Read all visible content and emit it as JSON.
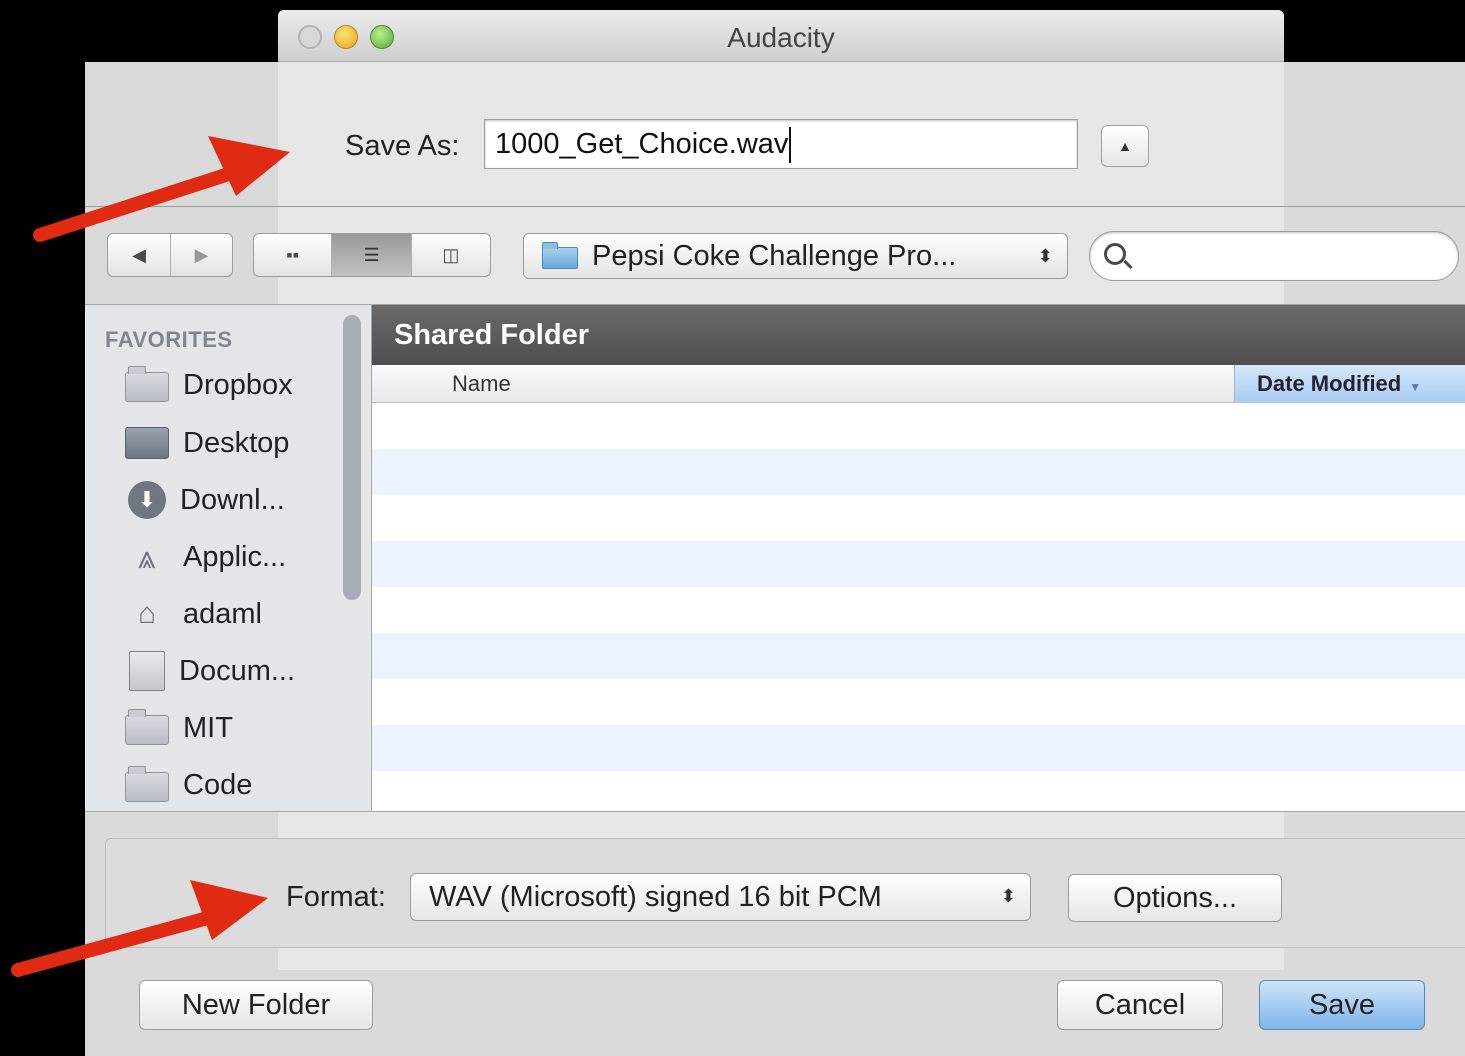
{
  "window": {
    "title": "Audacity",
    "controls": [
      "close",
      "minimize",
      "zoom"
    ]
  },
  "save_as": {
    "label": "Save As:",
    "value": "1000_Get_Choice.wav",
    "expand_icon": "triangle-up-icon"
  },
  "toolbar": {
    "back_icon": "◀",
    "forward_icon": "▶",
    "view_icon_grid": "▪▪",
    "view_icon_list": "☰",
    "view_icon_columns": "◫",
    "location": "Pepsi Coke Challenge Pro...",
    "search_placeholder": ""
  },
  "sidebar": {
    "heading": "FAVORITES",
    "items": [
      {
        "label": "Dropbox",
        "icon": "folder-icon"
      },
      {
        "label": "Desktop",
        "icon": "desktop-icon"
      },
      {
        "label": "Downl...",
        "icon": "download-icon"
      },
      {
        "label": "Applic...",
        "icon": "applications-icon"
      },
      {
        "label": "adaml",
        "icon": "home-icon"
      },
      {
        "label": "Docum...",
        "icon": "documents-icon"
      },
      {
        "label": "MIT",
        "icon": "folder-icon"
      },
      {
        "label": "Code",
        "icon": "folder-icon"
      }
    ]
  },
  "file_list": {
    "folder_title": "Shared Folder",
    "columns": [
      "Name",
      "Date Modified"
    ],
    "sorted_column": "Date Modified",
    "rows": []
  },
  "format": {
    "label": "Format:",
    "value": "WAV (Microsoft) signed 16 bit PCM",
    "options_label": "Options..."
  },
  "buttons": {
    "new_folder": "New Folder",
    "cancel": "Cancel",
    "save": "Save"
  },
  "colors": {
    "annotation_arrow": "#e02a12",
    "default_button": "#7fb4ea",
    "list_header": "#585858"
  }
}
